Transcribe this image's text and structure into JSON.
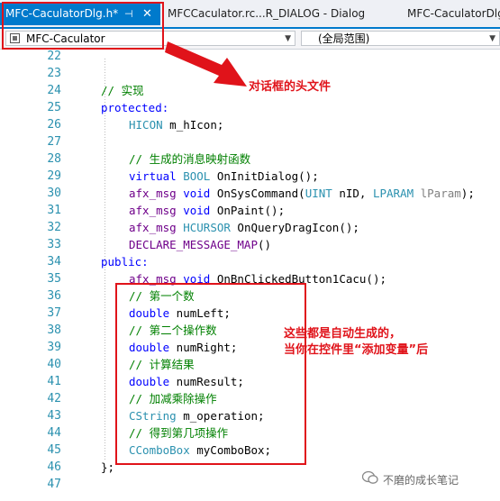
{
  "tabs": [
    {
      "label": "MFC-CaculatorDlg.h*",
      "pin": "⊣",
      "close": "✕"
    },
    {
      "label": "MFCCaculator.rc...R_DIALOG - Dialog"
    },
    {
      "label": "MFC-CaculatorDlg.h"
    }
  ],
  "navbar": {
    "class_combo": "MFC-Caculator",
    "scope_combo": "(全局范围)"
  },
  "line_numbers": [
    "22",
    "23",
    "24",
    "25",
    "26",
    "27",
    "28",
    "29",
    "30",
    "31",
    "32",
    "33",
    "34",
    "35",
    "36",
    "37",
    "38",
    "39",
    "40",
    "41",
    "42",
    "43",
    "44",
    "45",
    "46",
    "47"
  ],
  "code": {
    "l24": "// 实现",
    "l25": "protected:",
    "l26a": "HICON",
    "l26b": " m_hIcon;",
    "l28": "// 生成的消息映射函数",
    "l29a": "virtual",
    "l29b": " BOOL",
    "l29c": " OnInitDialog();",
    "l30a": "afx_msg",
    "l30b": " void",
    "l30c": " OnSysCommand(",
    "l30d": "UINT",
    "l30e": " nID, ",
    "l30f": "LPARAM",
    "l30g": " lParam",
    "l30h": ");",
    "l31a": "afx_msg",
    "l31b": " void",
    "l31c": " OnPaint();",
    "l32a": "afx_msg",
    "l32b": " HCURSOR",
    "l32c": " OnQueryDragIcon();",
    "l33": "DECLARE_MESSAGE_MAP",
    "l33b": "()",
    "l34": "public:",
    "l35a": "afx_msg",
    "l35b": " void",
    "l35c": " OnBnClickedButton1Cacu();",
    "l36": "// 第一个数",
    "l37a": "double",
    "l37b": " numLeft;",
    "l38": "// 第二个操作数",
    "l39a": "double",
    "l39b": " numRight;",
    "l40": "// 计算结果",
    "l41a": "double",
    "l41b": " numResult;",
    "l42": "// 加减乘除操作",
    "l43a": "CString",
    "l43b": " m_operation;",
    "l44": "// 得到第几项操作",
    "l45a": "CComboBox",
    "l45b": " myComboBox;",
    "l46": "};"
  },
  "annotations": {
    "header_note": "对话框的头文件",
    "auto_note_line1": "这些都是自动生成的，",
    "auto_note_line2": "当你在控件里“添加变量”后"
  },
  "watermark": "不磨的成长笔记",
  "colors": {
    "accent": "#007acc",
    "annotation_red": "#e0131a",
    "keyword": "#0000ff",
    "comment": "#008000",
    "type": "#2b91af",
    "macro": "#6f008a"
  }
}
